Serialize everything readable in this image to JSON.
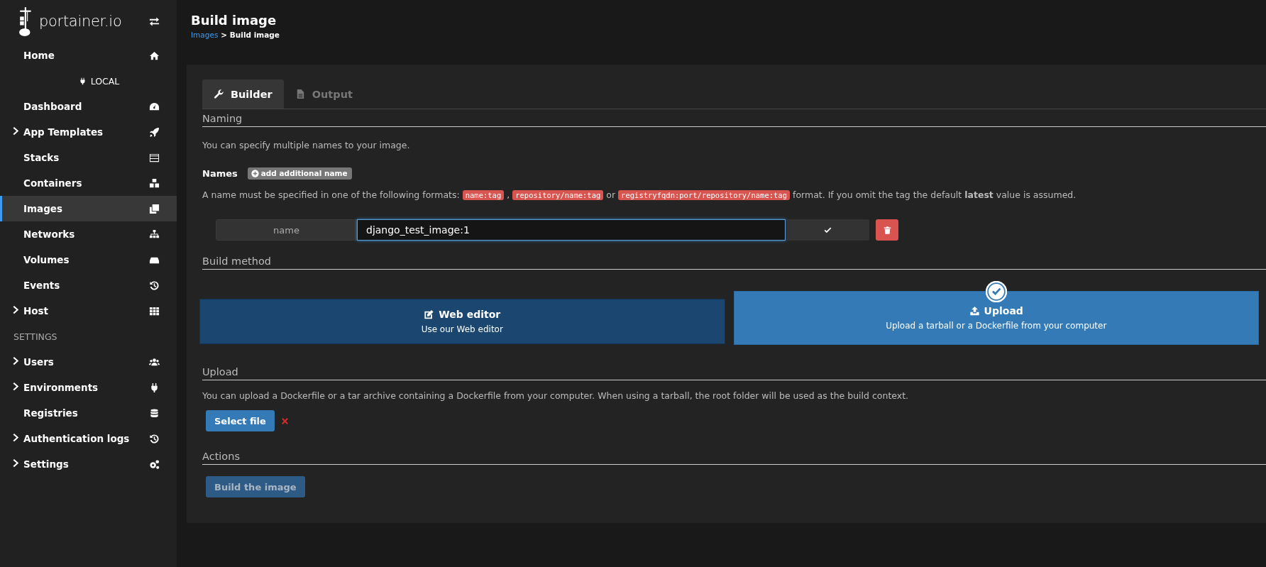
{
  "sidebar": {
    "logo": "portainer.io",
    "items": [
      {
        "label": "Home",
        "expandable": false,
        "selected": false
      },
      {
        "kind": "env",
        "label": "LOCAL"
      },
      {
        "label": "Dashboard",
        "expandable": false,
        "selected": false
      },
      {
        "label": "App Templates",
        "expandable": true,
        "selected": false
      },
      {
        "label": "Stacks",
        "expandable": false,
        "selected": false
      },
      {
        "label": "Containers",
        "expandable": false,
        "selected": false
      },
      {
        "label": "Images",
        "expandable": false,
        "selected": true
      },
      {
        "label": "Networks",
        "expandable": false,
        "selected": false
      },
      {
        "label": "Volumes",
        "expandable": false,
        "selected": false
      },
      {
        "label": "Events",
        "expandable": false,
        "selected": false
      },
      {
        "label": "Host",
        "expandable": true,
        "selected": false
      },
      {
        "kind": "heading",
        "label": "SETTINGS"
      },
      {
        "label": "Users",
        "expandable": true,
        "selected": false
      },
      {
        "label": "Environments",
        "expandable": true,
        "selected": false
      },
      {
        "label": "Registries",
        "expandable": false,
        "selected": false
      },
      {
        "label": "Authentication logs",
        "expandable": true,
        "selected": false
      },
      {
        "label": "Settings",
        "expandable": true,
        "selected": false
      }
    ]
  },
  "header": {
    "title": "Build image",
    "breadcrumb": {
      "link": "Images",
      "current": "> Build image"
    }
  },
  "tabs": [
    {
      "label": "Builder",
      "selected": true
    },
    {
      "label": "Output",
      "selected": false
    }
  ],
  "naming": {
    "heading": "Naming",
    "intro": "You can specify multiple names to your image.",
    "names_label": "Names",
    "add_button": "add additional name",
    "help": [
      {
        "kind": "text",
        "text": "A name must be specified in one of the following formats:"
      },
      {
        "kind": "code",
        "text": "name:tag"
      },
      {
        "kind": "text",
        "text": ","
      },
      {
        "kind": "code",
        "text": "repository/name:tag"
      },
      {
        "kind": "text",
        "text": "or"
      },
      {
        "kind": "code",
        "text": "registryfqdn:port/repository/name:tag"
      },
      {
        "kind": "text",
        "text": "format. If you omit the tag the default **latest** value is assumed."
      }
    ],
    "rows": [
      {
        "label": "name",
        "value": "django_test_image:1",
        "valid": true
      }
    ]
  },
  "build_method": {
    "heading": "Build method",
    "options": [
      {
        "title": "Web editor",
        "subtitle": "Use our Web editor",
        "selected": false
      },
      {
        "title": "Upload",
        "subtitle": "Upload a tarball or a Dockerfile from your computer",
        "selected": true
      }
    ]
  },
  "upload": {
    "heading": "Upload",
    "text": "You can upload a Dockerfile or a tar archive containing a Dockerfile from your computer. When using a tarball, the root folder will be used as the build context.",
    "button": "Select file",
    "file_selected": false
  },
  "actions": {
    "heading": "Actions",
    "button": "Build the image",
    "disabled": true
  }
}
